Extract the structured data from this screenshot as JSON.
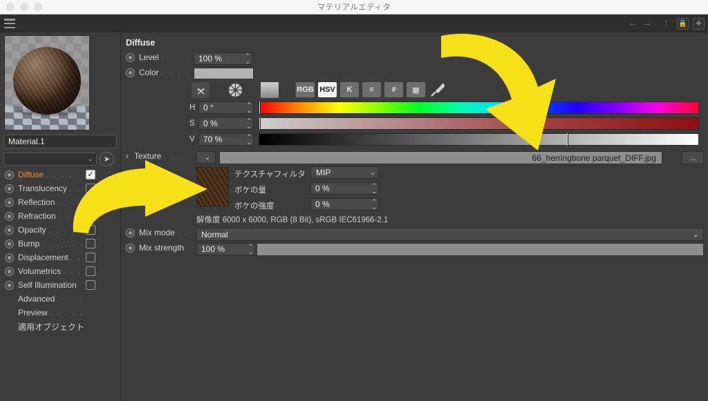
{
  "window": {
    "title": "マテリアルエディタ",
    "traffic_lights": [
      "close",
      "minimize",
      "zoom"
    ]
  },
  "toolbar": {
    "menu_icon": "hamburger-icon",
    "right_icons": [
      "arrow-left-icon",
      "arrow-right-icon",
      "arrow-up-icon",
      "lock-icon",
      "add-icon"
    ]
  },
  "sidebar": {
    "material_name": "Material.1",
    "selector_value": "",
    "picker_icon": "cursor-picker-icon",
    "channels": [
      {
        "label": "Diffuse",
        "dots": ". . . . . . .",
        "checked": true,
        "active": true,
        "has_radio": true,
        "has_checkbox": true
      },
      {
        "label": "Translucency",
        "dots": ". .",
        "checked": false,
        "active": false,
        "has_radio": true,
        "has_checkbox": true
      },
      {
        "label": "Reflection",
        "dots": ". . . .",
        "checked": false,
        "active": false,
        "has_radio": true,
        "has_checkbox": true
      },
      {
        "label": "Refraction",
        "dots": ". . . .",
        "checked": false,
        "active": false,
        "has_radio": true,
        "has_checkbox": true
      },
      {
        "label": "Opacity",
        "dots": ". . . . . .",
        "checked": false,
        "active": false,
        "has_radio": true,
        "has_checkbox": true
      },
      {
        "label": "Bump",
        "dots": ". . . . . . . .",
        "checked": false,
        "active": false,
        "has_radio": true,
        "has_checkbox": true
      },
      {
        "label": "Displacement",
        "dots": ". .",
        "checked": false,
        "active": false,
        "has_radio": true,
        "has_checkbox": true
      },
      {
        "label": "Volumetrics",
        "dots": ". . .",
        "checked": false,
        "active": false,
        "has_radio": true,
        "has_checkbox": true
      },
      {
        "label": "Self Illumination",
        "dots": "",
        "checked": false,
        "active": false,
        "has_radio": true,
        "has_checkbox": true
      },
      {
        "label": "Advanced",
        "dots": ". . . .",
        "checked": false,
        "active": false,
        "has_radio": false,
        "has_checkbox": false
      },
      {
        "label": "Preview",
        "dots": ". . . . . .",
        "checked": false,
        "active": false,
        "has_radio": false,
        "has_checkbox": false
      },
      {
        "label": "適用オブジェクト",
        "dots": "",
        "checked": false,
        "active": false,
        "has_radio": false,
        "has_checkbox": false
      }
    ]
  },
  "main": {
    "section_title": "Diffuse",
    "level": {
      "label": "Level",
      "dots": ". . . . . .",
      "value": "100 %"
    },
    "color": {
      "label": "Color",
      "dots": ". . . .",
      "swatch_hex": "#b3b3b3",
      "chevron": "chevron-down-icon"
    },
    "color_tools": [
      {
        "name": "collapse-expand-icon",
        "glyph": "⌄"
      },
      {
        "name": "color-wheel-icon",
        "glyph": "✳"
      },
      {
        "name": "gradient-swatch-icon",
        "glyph": ""
      },
      {
        "name": "image-picker-icon",
        "glyph": "▲"
      }
    ],
    "color_modes": [
      {
        "label": "RGB",
        "selected": false
      },
      {
        "label": "HSV",
        "selected": true
      },
      {
        "label": "K",
        "selected": false
      },
      {
        "label": "≡",
        "selected": false,
        "name": "sliders-icon"
      },
      {
        "label": "#",
        "selected": false,
        "name": "hex-icon"
      },
      {
        "label": "▦",
        "selected": false,
        "name": "swatch-grid-icon"
      }
    ],
    "eyedropper_icon": "eyedropper-icon",
    "hsv": [
      {
        "key": "H",
        "value": "0 °",
        "handle_pct": 0
      },
      {
        "key": "S",
        "value": "0 %",
        "handle_pct": 0
      },
      {
        "key": "V",
        "value": "70 %",
        "handle_pct": 70
      }
    ],
    "texture": {
      "label": "Texture",
      "dots": ". . .",
      "expander_icon": "chevron-right-icon",
      "dropdown_icon": "chevron-down-icon",
      "path": "66_herringbone parquet_DIFF.jpg",
      "browse_label": "...",
      "filter_label": "テクスチャフィルタ",
      "filter_value": "MIP",
      "blur_offset_label": "ボケの量",
      "blur_offset_value": "0 %",
      "blur_scale_label": "ボケの強度",
      "blur_scale_value": "0 %",
      "resolution_info": "解像度 6000 x 6000, RGB (8 Bit), sRGB IEC61966-2.1"
    },
    "mix_mode": {
      "label": "Mix mode",
      "dots": ". .",
      "value": "Normal"
    },
    "mix_strength": {
      "label": "Mix strength",
      "dots": "",
      "value": "100 %",
      "fill_pct": 100
    }
  },
  "annotations": {
    "arrows": [
      "yellow-arrow-down-right",
      "yellow-arrow-right"
    ],
    "color_hex": "#f6e018"
  }
}
